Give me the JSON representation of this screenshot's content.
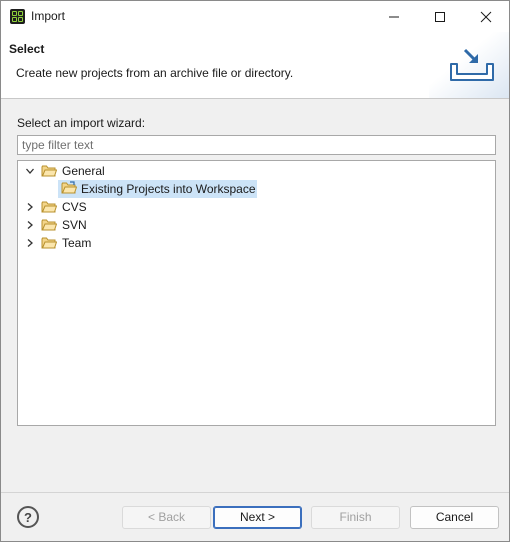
{
  "window": {
    "title": "Import",
    "app_icon": "eclipse-app-icon",
    "controls": [
      "minimize-icon",
      "maximize-icon",
      "close-icon"
    ]
  },
  "banner": {
    "title": "Select",
    "description": "Create new projects from an archive file or directory.",
    "icon": "import-tray-icon"
  },
  "wizard": {
    "label": "Select an import wizard:",
    "filter_placeholder": "type filter text",
    "filter_value": "",
    "tree": [
      {
        "label": "General",
        "expanded": true,
        "icon": "folder-icon",
        "children": [
          {
            "label": "Existing Projects into Workspace",
            "selected": true,
            "icon": "folder-open-icon"
          }
        ]
      },
      {
        "label": "CVS",
        "expanded": false,
        "icon": "folder-icon"
      },
      {
        "label": "SVN",
        "expanded": false,
        "icon": "folder-icon"
      },
      {
        "label": "Team",
        "expanded": false,
        "icon": "folder-icon"
      }
    ]
  },
  "footer": {
    "help": "?",
    "back_label": "< Back",
    "next_label": "Next >",
    "finish_label": "Finish",
    "cancel_label": "Cancel"
  },
  "colors": {
    "selection": "#cce3f7",
    "default_button_border": "#3b6fbd",
    "folder_fill": "#f3d58a",
    "folder_stroke": "#b8912d"
  }
}
